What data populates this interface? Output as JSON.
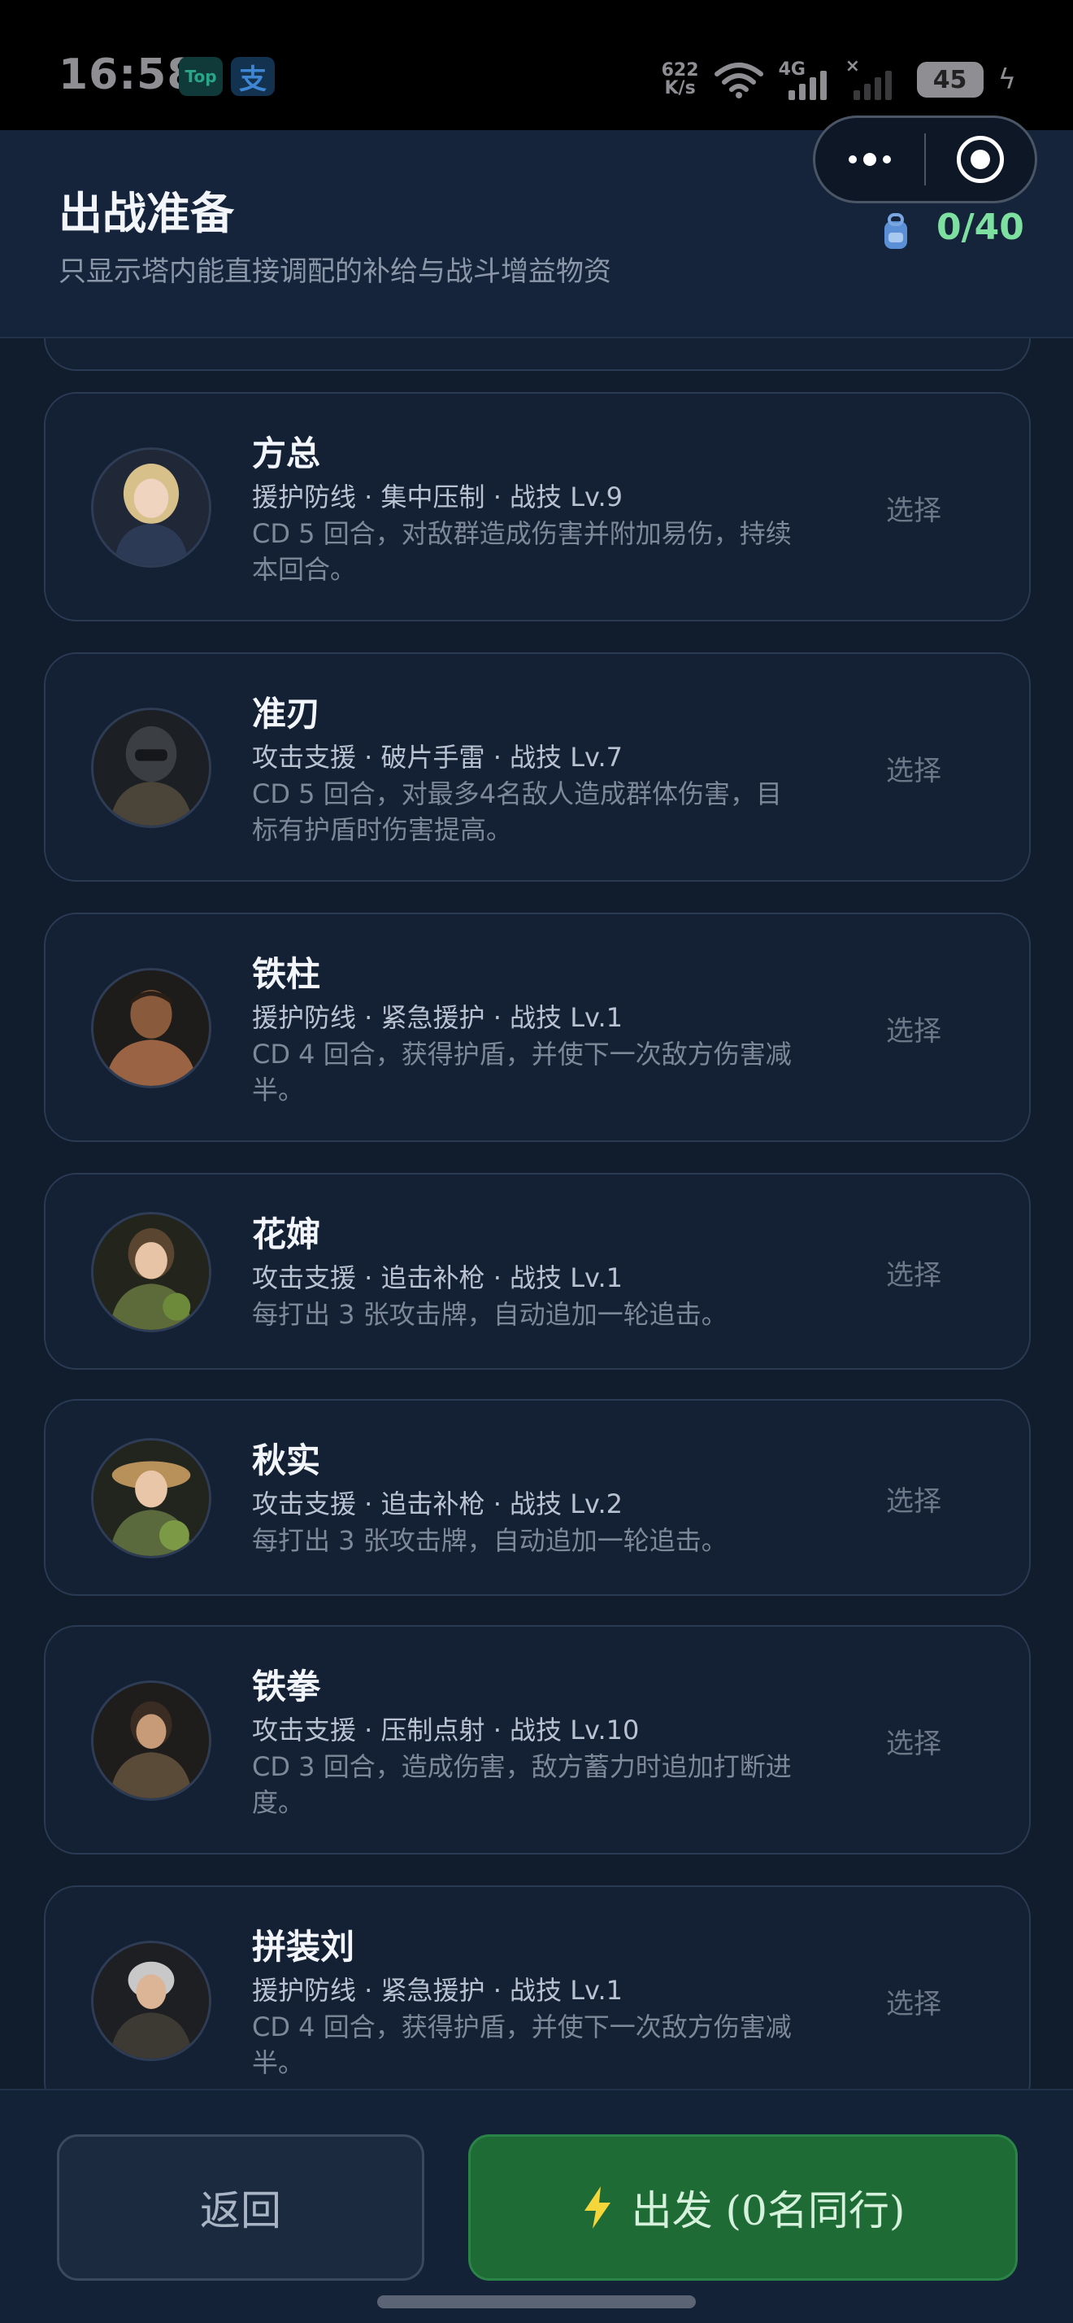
{
  "status_bar": {
    "time": "16:58",
    "app_badges": [
      "Top",
      "支"
    ],
    "net_speed_value": "622",
    "net_speed_unit": "K/s",
    "network_type": "4G",
    "second_sim": "×",
    "battery": "45"
  },
  "header": {
    "title": "出战准备",
    "subtitle": "只显示塔内能直接调配的补给与战斗增益物资",
    "count": "0/40"
  },
  "cards": [
    {
      "name": "方总",
      "meta": "援护防线 · 集中压制 · 战技 Lv.9",
      "desc": "CD 5 回合，对敌群造成伤害并附加易伤，持续本回合。",
      "action": "选择"
    },
    {
      "name": "准刃",
      "meta": "攻击支援 · 破片手雷 · 战技 Lv.7",
      "desc": "CD 5 回合，对最多4名敌人造成群体伤害，目标有护盾时伤害提高。",
      "action": "选择"
    },
    {
      "name": "铁柱",
      "meta": "援护防线 · 紧急援护 · 战技 Lv.1",
      "desc": "CD 4 回合，获得护盾，并使下一次敌方伤害减半。",
      "action": "选择"
    },
    {
      "name": "花婶",
      "meta": "攻击支援 · 追击补枪 · 战技 Lv.1",
      "desc": "每打出 3 张攻击牌，自动追加一轮追击。",
      "action": "选择"
    },
    {
      "name": "秋实",
      "meta": "攻击支援 · 追击补枪 · 战技 Lv.2",
      "desc": "每打出 3 张攻击牌，自动追加一轮追击。",
      "action": "选择"
    },
    {
      "name": "铁拳",
      "meta": "攻击支援 · 压制点射 · 战技 Lv.10",
      "desc": "CD 3 回合，造成伤害，敌方蓄力时追加打断进度。",
      "action": "选择"
    },
    {
      "name": "拼装刘",
      "meta": "援护防线 · 紧急援护 · 战技 Lv.1",
      "desc": "CD 4 回合，获得护盾，并使下一次敌方伤害减半。",
      "action": "选择"
    }
  ],
  "footer": {
    "back_label": "返回",
    "go_label": "出发 (0名同行)"
  },
  "colors": {
    "accent_green": "#1f6b35",
    "count_green": "#7ee0a0",
    "background": "#111c2c"
  }
}
